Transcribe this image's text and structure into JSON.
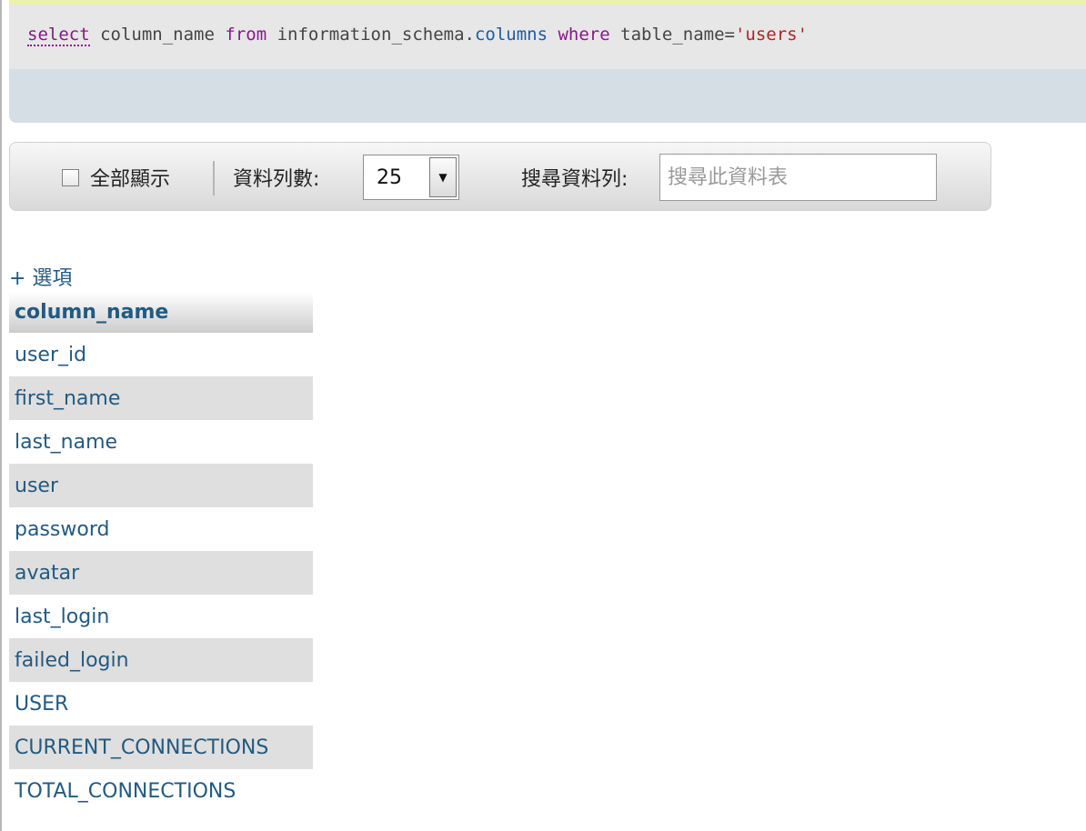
{
  "sql": {
    "keyword_select": "select",
    "column": "column_name",
    "keyword_from": "from",
    "schema": "information_schema.",
    "table": "columns",
    "keyword_where": "where",
    "condition": "table_name=",
    "value": "'users'"
  },
  "toolbar": {
    "show_all_label": "全部顯示",
    "rows_label": "資料列數:",
    "rows_value": "25",
    "search_label": "搜尋資料列:",
    "search_placeholder": "搜尋此資料表"
  },
  "options_link": "+ 選項",
  "table": {
    "header": "column_name",
    "rows": [
      "user_id",
      "first_name",
      "last_name",
      "user",
      "password",
      "avatar",
      "last_login",
      "failed_login",
      "USER",
      "CURRENT_CONNECTIONS",
      "TOTAL_CONNECTIONS"
    ]
  },
  "colors": {
    "keyword": "#8a178a",
    "table_name": "#1a5ca8",
    "string": "#b22222",
    "link": "#235a81",
    "row_stripe": "#dfdfdf"
  },
  "icons": {
    "dropdown": "chevron-down-icon",
    "checkbox": "checkbox-icon"
  }
}
